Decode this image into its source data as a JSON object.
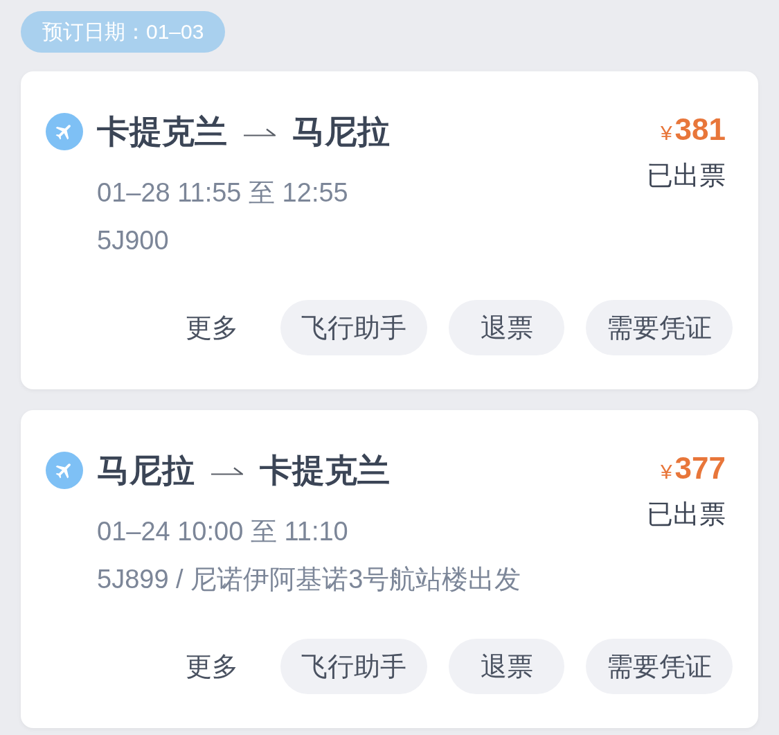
{
  "booking_date": {
    "label": "预订日期：01–03"
  },
  "orders": [
    {
      "from": "卡提克兰",
      "to": "马尼拉",
      "price": {
        "currency": "¥",
        "amount": "381"
      },
      "status": "已出票",
      "time": "01–28 11:55 至 12:55",
      "details": "5J900",
      "actions": [
        {
          "label": "更多",
          "kind": "link"
        },
        {
          "label": "飞行助手",
          "kind": "button"
        },
        {
          "label": "退票",
          "kind": "button"
        },
        {
          "label": "需要凭证",
          "kind": "button"
        }
      ]
    },
    {
      "from": "马尼拉",
      "to": "卡提克兰",
      "price": {
        "currency": "¥",
        "amount": "377"
      },
      "status": "已出票",
      "time": "01–24 10:00 至 11:10",
      "details": "5J899 / 尼诺伊阿基诺3号航站楼出发",
      "actions": [
        {
          "label": "更多",
          "kind": "link"
        },
        {
          "label": "飞行助手",
          "kind": "button"
        },
        {
          "label": "退票",
          "kind": "button"
        },
        {
          "label": "需要凭证",
          "kind": "button"
        }
      ]
    }
  ]
}
